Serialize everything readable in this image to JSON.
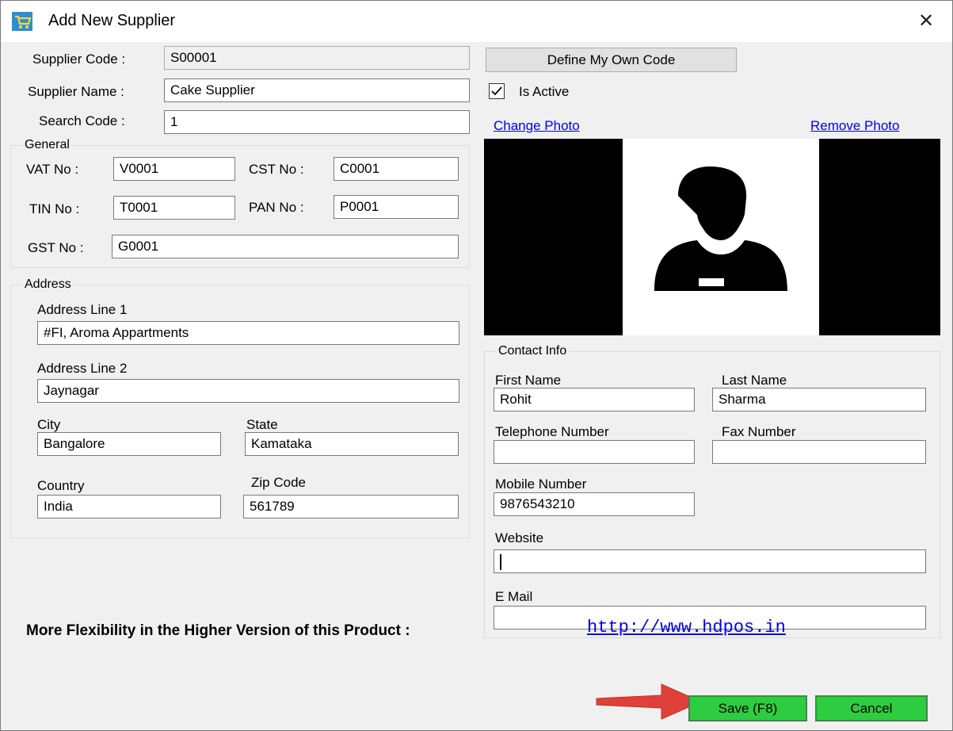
{
  "window": {
    "title": "Add New Supplier",
    "close_glyph": "✕"
  },
  "supplier": {
    "code_label": "Supplier Code :",
    "code_value": "S00001",
    "name_label": "Supplier Name :",
    "name_value": "Cake Supplier",
    "search_label": "Search Code :",
    "search_value": "1",
    "define_code_button": "Define My Own Code",
    "is_active_label": "Is Active",
    "is_active_checked": true
  },
  "general": {
    "group_title": "General",
    "vat_label": "VAT No :",
    "vat_value": "V0001",
    "cst_label": "CST No :",
    "cst_value": "C0001",
    "tin_label": "TIN No :",
    "tin_value": "T0001",
    "pan_label": "PAN No :",
    "pan_value": "P0001",
    "gst_label": "GST No :",
    "gst_value": "G0001"
  },
  "address": {
    "group_title": "Address",
    "line1_label": "Address Line 1",
    "line1_value": "#FI, Aroma Appartments",
    "line2_label": "Address Line 2",
    "line2_value": "Jaynagar",
    "city_label": "City",
    "city_value": "Bangalore",
    "state_label": "State",
    "state_value": "Kamataka",
    "country_label": "Country",
    "country_value": "India",
    "zip_label": "Zip Code",
    "zip_value": "561789"
  },
  "photo": {
    "change_link": "Change Photo",
    "remove_link": "Remove Photo"
  },
  "contact": {
    "group_title": "Contact Info",
    "first_name_label": "First Name",
    "first_name_value": "Rohit",
    "last_name_label": "Last Name",
    "last_name_value": "Sharma",
    "telephone_label": "Telephone Number",
    "telephone_value": "",
    "fax_label": "Fax Number",
    "fax_value": "",
    "mobile_label": "Mobile Number",
    "mobile_value": "9876543210",
    "website_label": "Website",
    "website_value": "",
    "email_label": "E Mail",
    "email_value": ""
  },
  "footer": {
    "message": "More Flexibility in the Higher Version of this Product :",
    "link": "http://www.hdpos.in",
    "save_button": "Save (F8)",
    "cancel_button": "Cancel"
  },
  "colors": {
    "button_green": "#2ecc40",
    "link_blue": "#0000ee",
    "arrow_red": "#e0403a",
    "dialog_bg": "#f0f0f0"
  }
}
